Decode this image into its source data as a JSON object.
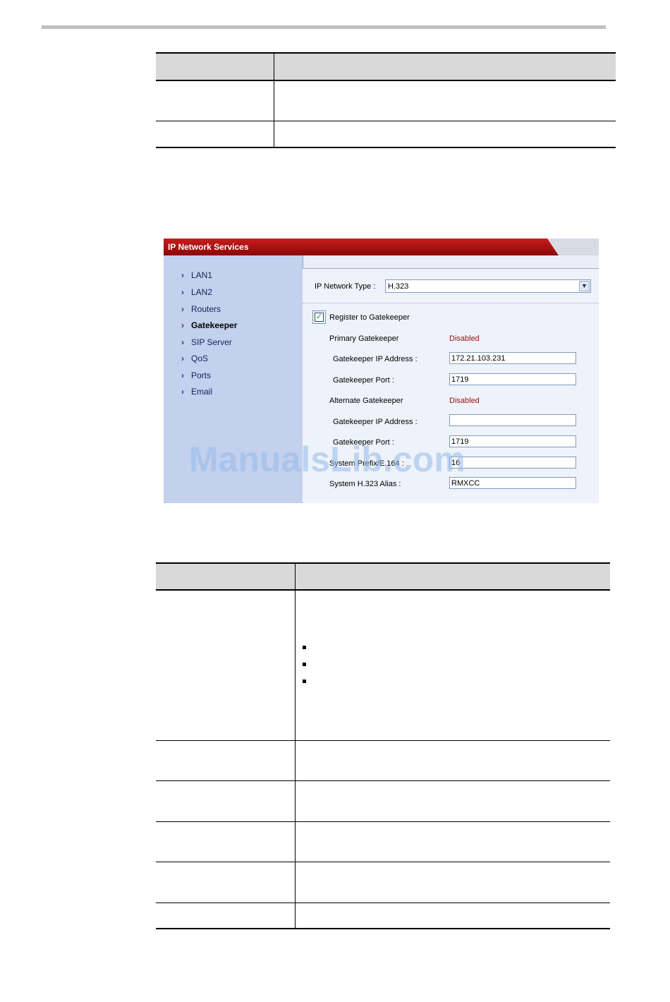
{
  "panel": {
    "title": "IP Network Services",
    "nav": [
      "LAN1",
      "LAN2",
      "Routers",
      "Gatekeeper",
      "SIP Server",
      "QoS",
      "Ports",
      "Email"
    ],
    "nav_active": "Gatekeeper",
    "network_type_label": "IP Network Type :",
    "network_type_value": "H.323",
    "register_label": "Register to Gatekeeper",
    "primary_label": "Primary Gatekeeper",
    "primary_status": "Disabled",
    "gk_ip_label": "Gatekeeper IP Address :",
    "gk_ip_value": "172.21.103.231",
    "gk_port_label": "Gatekeeper Port :",
    "gk_port_value": "1719",
    "alternate_label": "Alternate Gatekeeper",
    "alternate_status": "Disabled",
    "alt_ip_label": "Gatekeeper IP Address :",
    "alt_ip_value": "",
    "alt_port_label": "Gatekeeper Port :",
    "alt_port_value": "1719",
    "prefix_label": "System Prefix/E.164 :",
    "prefix_value": "16",
    "alias_label": "System H.323 Alias :",
    "alias_value": "RMXCC"
  },
  "watermark": "ManualsLib.com",
  "colors": {
    "title_bar": "#a00d0d",
    "nav_bg": "#c3d1ee",
    "status_red": "#a01010"
  }
}
